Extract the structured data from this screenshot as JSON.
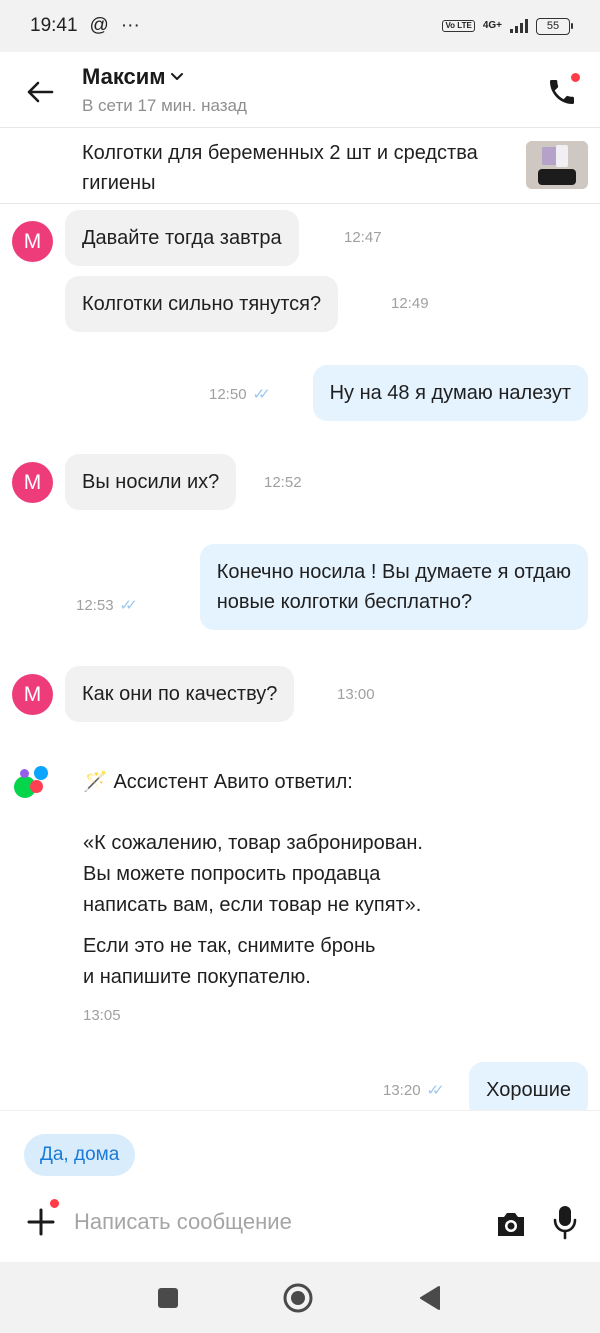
{
  "status_bar": {
    "time": "19:41",
    "at_glyph": "@",
    "more_glyph": "···",
    "volte": "Vo LTE",
    "network": "4G+",
    "battery": "55"
  },
  "header": {
    "contact_name": "Максим",
    "contact_status": "В сети 17 мин. назад"
  },
  "item": {
    "title": "Колготки для беременных 2 шт и средства гигиены"
  },
  "messages": [
    {
      "avatar_letter": "М",
      "text": "Давайте тогда завтра",
      "time": "12:47"
    },
    {
      "text": "Колготки сильно тянутся?",
      "time": "12:49"
    },
    {
      "text": "Ну на 48 я думаю налезут",
      "time": "12:50"
    },
    {
      "avatar_letter": "М",
      "text": "Вы носили их?",
      "time": "12:52"
    },
    {
      "text_line1": "Конечно носила ! Вы думаете я отдаю",
      "text_line2": "новые колготки бесплатно?",
      "time": "12:53"
    },
    {
      "avatar_letter": "М",
      "text": "Как они по качеству?",
      "time": "13:00"
    },
    {
      "text": "Хорошие",
      "time": "13:20"
    }
  ],
  "assistant": {
    "emoji": "🪄",
    "heading": "Ассистент Авито ответил:",
    "quote_line1": "«К сожалению, товар забронирован.",
    "quote_line2": "Вы можете попросить продавца",
    "quote_line3": "написать вам, если товар не купят».",
    "note_line1": "Если это не так, снимите бронь",
    "note_line2": "и напишите покупателю.",
    "time": "13:05"
  },
  "quick_reply": "Да, дома",
  "composer": {
    "placeholder": "Написать сообщение"
  },
  "colors": {
    "avatar": "#ee3c7b",
    "outgoing_bubble": "#e5f3fe",
    "incoming_bubble": "#f1f1f1",
    "chip_bg": "#d9ecfb",
    "chip_text": "#1b7ad6",
    "notification_dot": "#ff3b46"
  },
  "icons": [
    "back-arrow-icon",
    "chevron-down-icon",
    "phone-icon",
    "read-checks-icon",
    "avito-logo-icon",
    "plus-icon",
    "camera-icon",
    "microphone-icon",
    "nav-recents-icon",
    "nav-home-icon",
    "nav-back-icon"
  ]
}
